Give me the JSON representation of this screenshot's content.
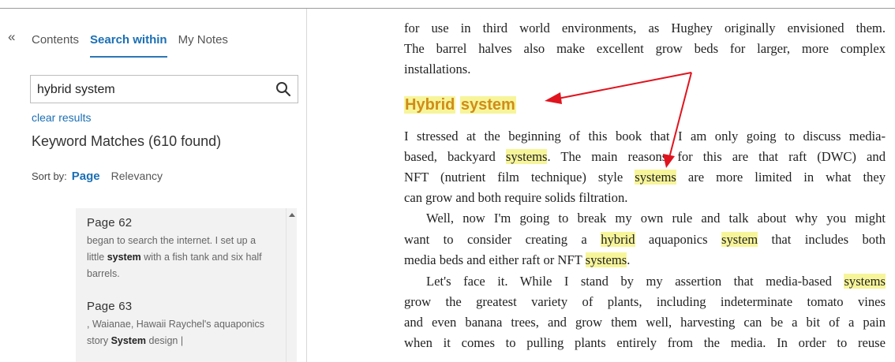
{
  "sidebar": {
    "collapse_label": "«",
    "tabs": [
      {
        "label": "Contents",
        "active": false
      },
      {
        "label": "Search within",
        "active": true
      },
      {
        "label": "My Notes",
        "active": false
      }
    ],
    "search": {
      "value": "hybrid system",
      "icon": "search-icon"
    },
    "clear_results": "clear results",
    "matches": "Keyword Matches (610 found)",
    "sort": {
      "label": "Sort by:",
      "page": "Page",
      "relevancy": "Relevancy"
    },
    "results": [
      {
        "page": "Page 62",
        "pre": "began to search the internet. I set up a little ",
        "bold": "system",
        "post": " with a fish tank and six half barrels."
      },
      {
        "page": "Page 63",
        "pre": ", Waianae, Hawaii Raychel's aquaponics story ",
        "bold": "System",
        "post": " design |"
      }
    ]
  },
  "book": {
    "line1": "for use in third world environments, as Hughey originally envisioned them.",
    "line2": "The barrel halves also make excellent grow beds for larger, more complex",
    "line3": "installations.",
    "heading_a": "Hybrid",
    "heading_b": "system",
    "p1_l1": "I stressed at the beginning of this book that I am only going to discuss media-",
    "p1_l2_a": "based, backyard ",
    "p1_l2_hl": "systems",
    "p1_l2_b": ". The main reasons for this are that raft (DWC) and",
    "p1_l3_a": "NFT (nutrient film technique) style ",
    "p1_l3_hl": "systems",
    "p1_l3_b": " are more limited in what they",
    "p1_l4": "can grow and both require solids filtration.",
    "p2_l1": "Well, now I'm going to break my own rule and talk about why you might",
    "p2_l2_a": "want to consider creating a ",
    "p2_l2_hl1": "hybrid",
    "p2_l2_b": " aquaponics ",
    "p2_l2_hl2": "system",
    "p2_l2_c": " that includes both",
    "p2_l3_a": "media beds and either raft or NFT ",
    "p2_l3_hl": "systems",
    "p2_l3_b": ".",
    "p3_l1_a": "Let's face it. While I stand by my assertion that media-based ",
    "p3_l1_hl": "systems",
    "p3_l2": "grow the greatest variety of plants, including indeterminate tomato vines",
    "p3_l3": "and even banana trees, and grow them well, harvesting can be a bit of a pain",
    "p3_l4": "when it comes to pulling plants entirely from the media. In order to reuse"
  },
  "colors": {
    "accent": "#1a6fb5",
    "highlight": "#f7f59a",
    "heading": "#d08c1a",
    "arrow": "#e0141e"
  }
}
